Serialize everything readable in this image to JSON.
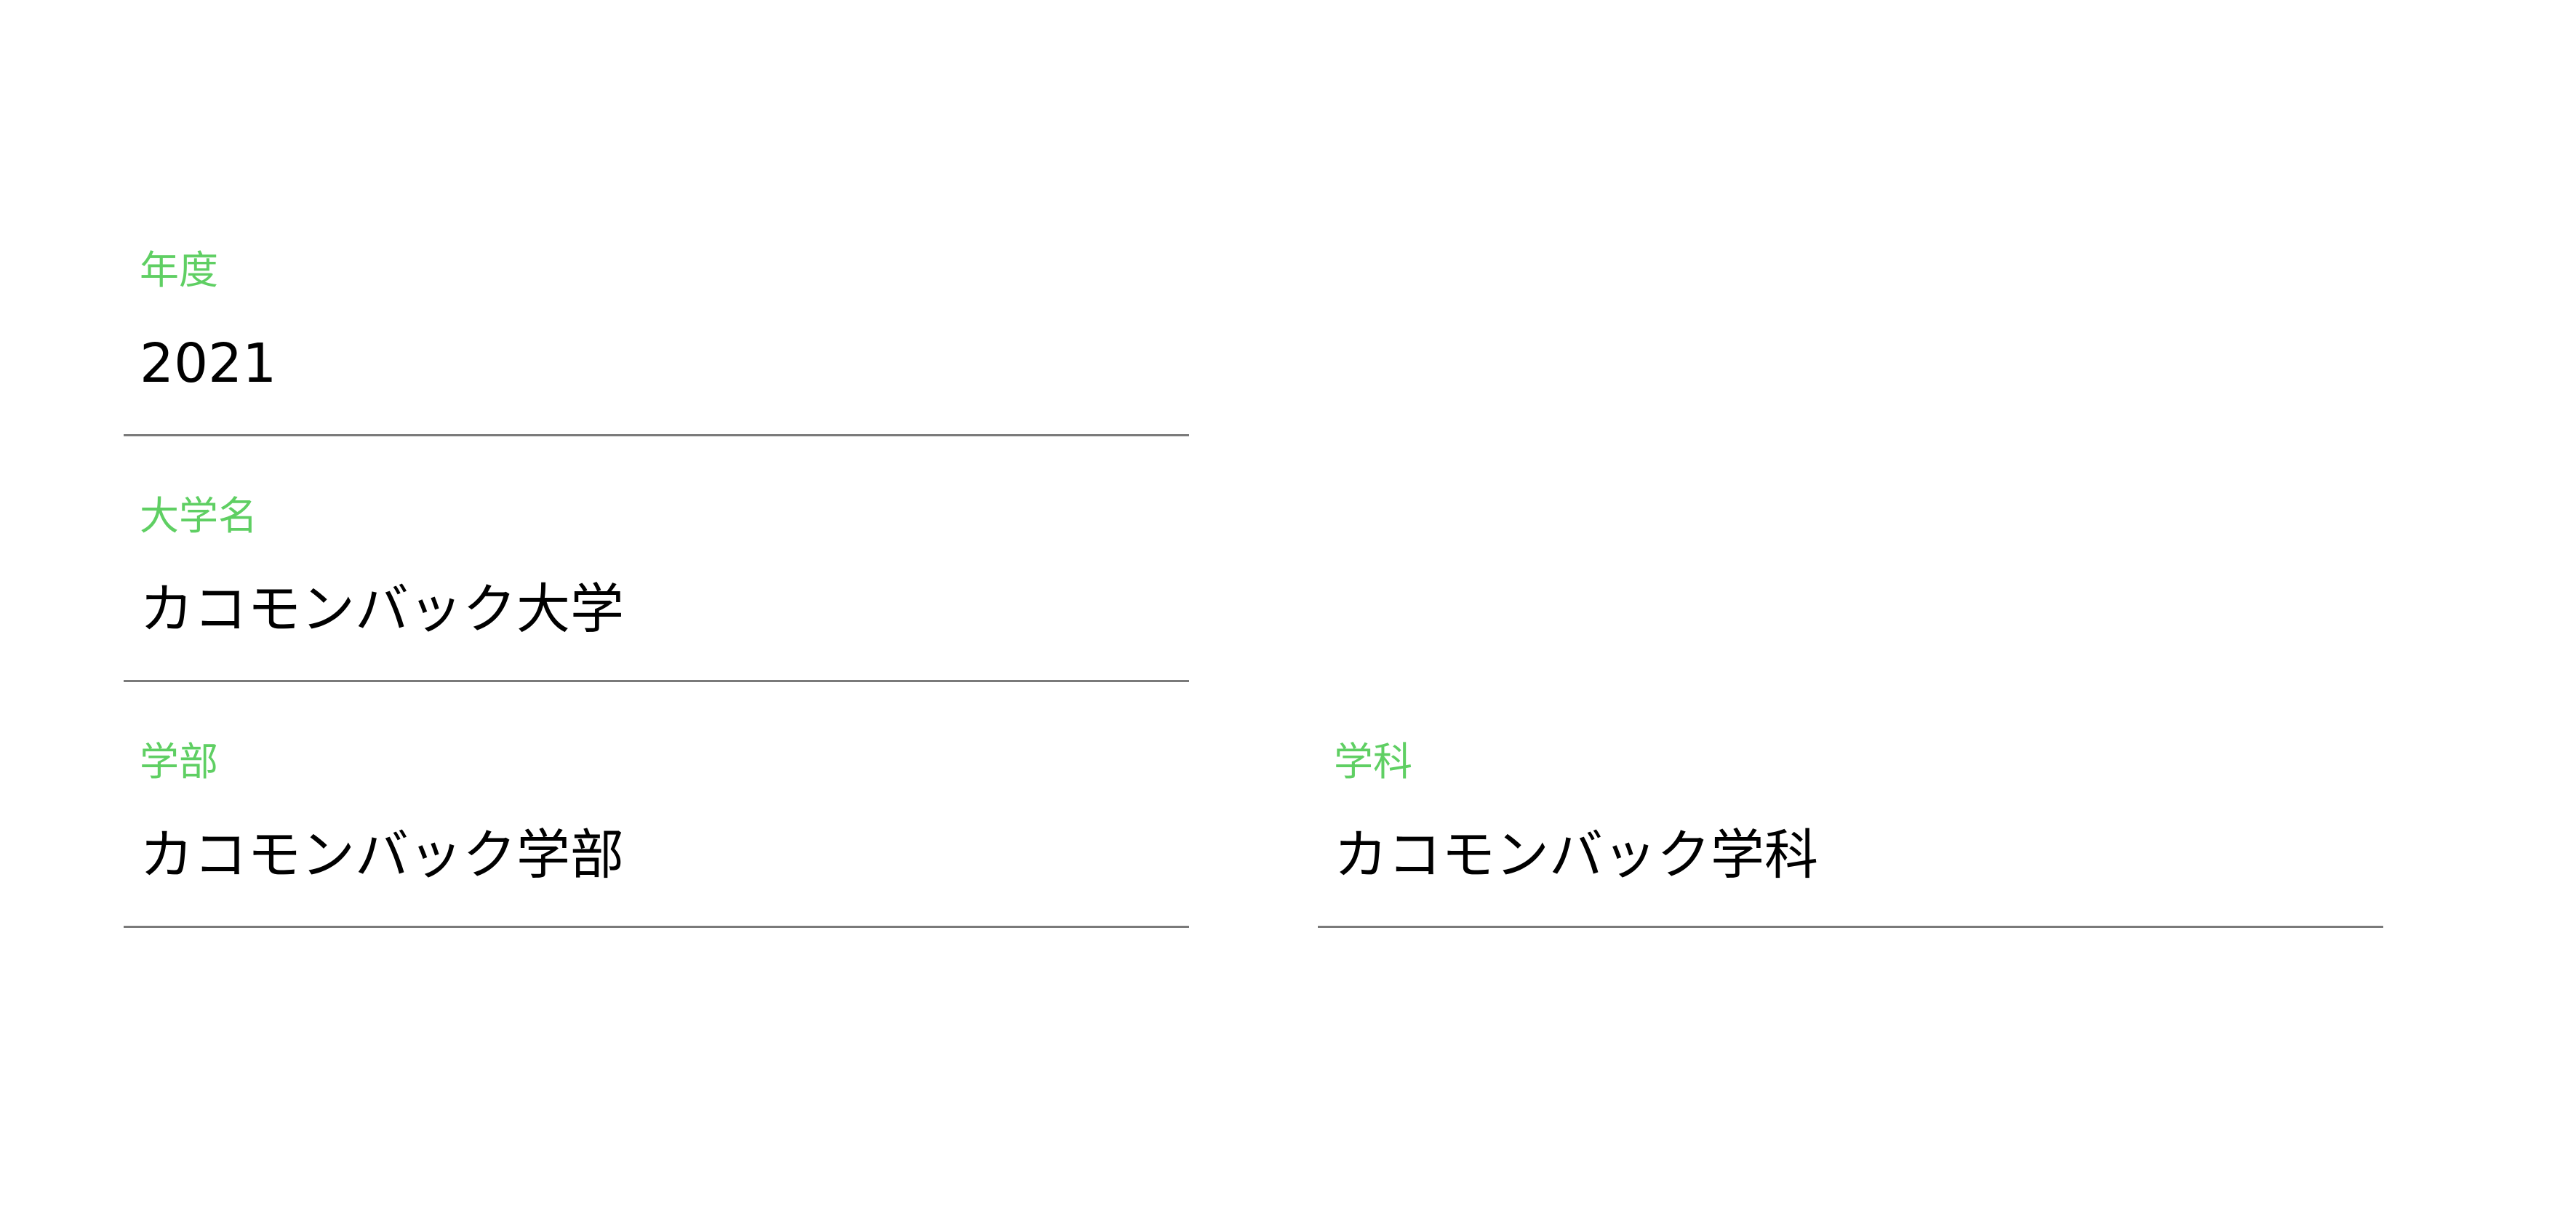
{
  "form": {
    "year": {
      "label": "年度",
      "value": "2021"
    },
    "university": {
      "label": "大学名",
      "value": "カコモンバック大学"
    },
    "faculty": {
      "label": "学部",
      "value": "カコモンバック学部"
    },
    "department": {
      "label": "学科",
      "value": "カコモンバック学科"
    },
    "accent_color": "#5fcf63",
    "underline_color": "#7a7a7a"
  }
}
